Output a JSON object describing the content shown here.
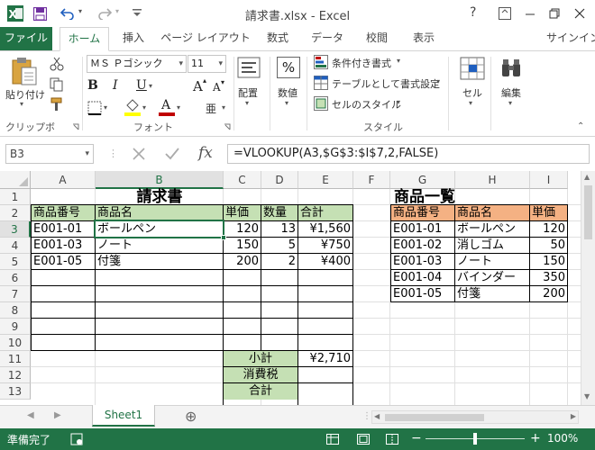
{
  "window": {
    "title": "請求書.xlsx - Excel",
    "help": "?",
    "controls": [
      "minimize",
      "restore",
      "close"
    ]
  },
  "tabs": {
    "file": "ファイル",
    "home": "ホーム",
    "insert": "挿入",
    "page_layout": "ページ レイアウト",
    "formulas": "数式",
    "data": "データ",
    "review": "校閲",
    "view": "表示",
    "signin": "サインイン"
  },
  "ribbon": {
    "paste": "貼り付け",
    "clipboard": "クリップボード",
    "font_name": "ＭＳ Ｐゴシック",
    "font_size": "11",
    "font_group": "フォント",
    "alignment": "配置",
    "number": "数値",
    "conditional": "条件付き書式",
    "table_format": "テーブルとして書式設定",
    "cell_style": "セルのスタイル",
    "style_group": "スタイル",
    "cells": "セル",
    "edit": "編集",
    "percent": "%",
    "bold": "B",
    "italic": "I",
    "underline": "U",
    "font_grow": "A",
    "font_shrink": "A",
    "font_color_letter": "A",
    "font_color": "#c00000",
    "fill_color": "#ffff00"
  },
  "formula_bar": {
    "name_box": "B3",
    "formula": "=VLOOKUP(A3,$G$3:$I$7,2,FALSE)",
    "fx": "fx"
  },
  "grid": {
    "columns": [
      "A",
      "B",
      "C",
      "D",
      "E",
      "F",
      "G",
      "H",
      "I"
    ],
    "rows": [
      "1",
      "2",
      "3",
      "4",
      "5",
      "6",
      "7",
      "8",
      "9",
      "10",
      "11",
      "12",
      "13"
    ],
    "selected_cell": "B3",
    "invoice": {
      "title": "請求書",
      "headers": [
        "商品番号",
        "商品名",
        "単価",
        "数量",
        "合計"
      ],
      "rows": [
        [
          "E001-01",
          "ボールペン",
          "120",
          "13",
          "¥1,560"
        ],
        [
          "E001-03",
          "ノート",
          "150",
          "5",
          "¥750"
        ],
        [
          "E001-05",
          "付箋",
          "200",
          "2",
          "¥400"
        ]
      ],
      "subtotal_label": "小計",
      "subtotal_value": "¥2,710",
      "tax_label": "消費税",
      "total_label": "合計"
    },
    "catalog": {
      "title": "商品一覧",
      "headers": [
        "商品番号",
        "商品名",
        "単価"
      ],
      "rows": [
        [
          "E001-01",
          "ボールペン",
          "120"
        ],
        [
          "E001-02",
          "消しゴム",
          "50"
        ],
        [
          "E001-03",
          "ノート",
          "150"
        ],
        [
          "E001-04",
          "バインダー",
          "350"
        ],
        [
          "E001-05",
          "付箋",
          "200"
        ]
      ]
    }
  },
  "sheets": {
    "active": "Sheet1",
    "add": "⊕"
  },
  "status": {
    "ready": "準備完了",
    "zoom": "100%",
    "minus": "−",
    "plus": "+"
  },
  "colors": {
    "accent": "#217346",
    "header_green": "#c5e0b4",
    "header_orange": "#f4b183"
  }
}
